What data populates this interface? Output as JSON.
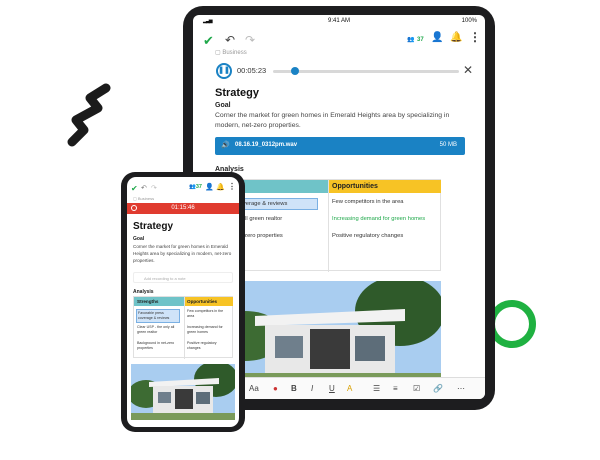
{
  "tablet": {
    "status": {
      "time": "9:41 AM",
      "battery": "100%"
    },
    "toolbar": {
      "share_count": "37"
    },
    "breadcrumb": "Business",
    "player": {
      "elapsed": "00:05:23",
      "progress": 0.12
    },
    "note": {
      "title": "Strategy",
      "goal_heading": "Goal",
      "goal_text": "Corner the market for green homes in Emerald Heights area by specializing in modern, net-zero properties."
    },
    "attachment": {
      "name": "08.16.19_0312pm.wav",
      "size": "50 MB"
    },
    "analysis": {
      "heading": "Analysis",
      "strengths_header": "ths",
      "opportunities_header": "Opportunities",
      "strengths": [
        "press coverage & reviews",
        "the only all green realtor",
        "ed in net-zero properties"
      ],
      "opportunities": [
        "Few competitors in the area",
        "Increasing demand for green homes",
        "Positive regulatory changes"
      ]
    },
    "format": {
      "font_label": "Aa"
    }
  },
  "phone": {
    "toolbar": {
      "share_count": "37"
    },
    "breadcrumb": "Business",
    "recording": {
      "time": "01:15:46"
    },
    "note": {
      "title": "Strategy",
      "goal_heading": "Goal",
      "goal_text": "Corner the market for green homes in Emerald Heights area by specializing in modern, net-zero properties.",
      "placeholder": "Add recording to a note"
    },
    "analysis": {
      "heading": "Analysis",
      "strengths_header": "Strengths",
      "opportunities_header": "Opportunities",
      "strengths": [
        "Favorable press coverage & reviews",
        "Clear USP - the only all green realtor",
        "Background in net-zero properties"
      ],
      "opportunities": [
        "Few competitors in the area",
        "Increasing demand for green homes",
        "Positive regulatory changes"
      ]
    }
  },
  "colors": {
    "accent_green": "#1fa84a",
    "accent_blue": "#1a82c4",
    "recording_red": "#e03b2f",
    "teal": "#6fc3c8",
    "yellow": "#f7c325"
  },
  "icons": [
    "check-icon",
    "undo-icon",
    "redo-icon",
    "share-icon",
    "person-icon",
    "bell-icon",
    "more-icon",
    "pause-icon",
    "close-icon",
    "speaker-icon",
    "bold-icon",
    "italic-icon",
    "underline-icon",
    "list-icon",
    "link-icon"
  ]
}
